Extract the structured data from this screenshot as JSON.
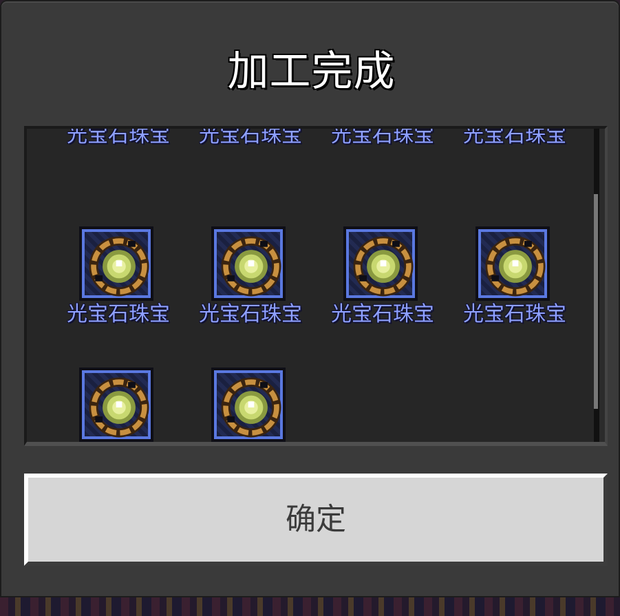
{
  "dialog": {
    "title": "加工完成",
    "confirm_label": "确定"
  },
  "items": [
    {
      "name": "光宝石珠宝",
      "icon": "light-gem-jewel-icon"
    },
    {
      "name": "光宝石珠宝",
      "icon": "light-gem-jewel-icon"
    },
    {
      "name": "光宝石珠宝",
      "icon": "light-gem-jewel-icon"
    },
    {
      "name": "光宝石珠宝",
      "icon": "light-gem-jewel-icon"
    },
    {
      "name": "光宝石珠宝",
      "icon": "light-gem-jewel-icon"
    },
    {
      "name": "光宝石珠宝",
      "icon": "light-gem-jewel-icon"
    },
    {
      "name": "光宝石珠宝",
      "icon": "light-gem-jewel-icon"
    },
    {
      "name": "光宝石珠宝",
      "icon": "light-gem-jewel-icon"
    },
    {
      "name": "",
      "icon": "light-gem-jewel-icon"
    },
    {
      "name": "",
      "icon": "light-gem-jewel-icon"
    }
  ],
  "colors": {
    "label": "#8ea0ff",
    "slot_border": "#5a78e0",
    "gem_glow": "#e8f0a0",
    "gem_ring": "#c89040"
  }
}
